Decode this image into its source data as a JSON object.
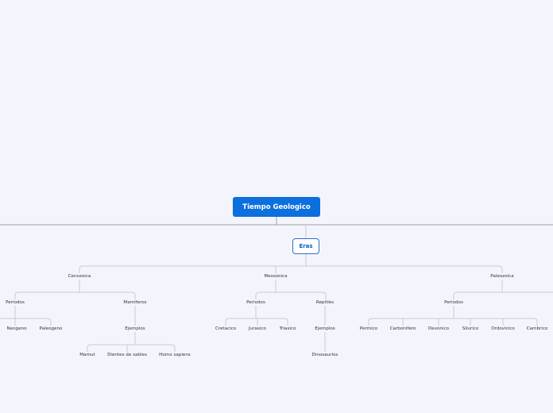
{
  "root": "Tiempo Geologico",
  "main_topic": "Eras",
  "colors": {
    "root_fill": "#0b6fde",
    "main_border": "#2e6fc9",
    "line": "#c6cad6",
    "background": "#f4f5fc"
  },
  "eras": [
    {
      "label": "Cenozoica",
      "groups": [
        {
          "label": "Periodos",
          "items": [
            "Neogeno",
            "Paleogeno"
          ]
        },
        {
          "label": "Mamiferos",
          "sub": "Ejemplos",
          "items": [
            "Mamut",
            "Dientes de sables",
            "Homo sapiens"
          ]
        }
      ]
    },
    {
      "label": "Mesozoica",
      "groups": [
        {
          "label": "Periodos",
          "items": [
            "Cretacico",
            "Jurasico",
            "Triasico"
          ]
        },
        {
          "label": "Reptiles",
          "sub": "Ejemplos",
          "items": [
            "Dinosaurios"
          ]
        }
      ]
    },
    {
      "label": "Paleozoica",
      "groups": [
        {
          "label": "Periodos",
          "items": [
            "Permico",
            "Carbonifero",
            "Devonico",
            "Silurico",
            "Ordovicico",
            "Cambrico"
          ]
        }
      ]
    }
  ]
}
